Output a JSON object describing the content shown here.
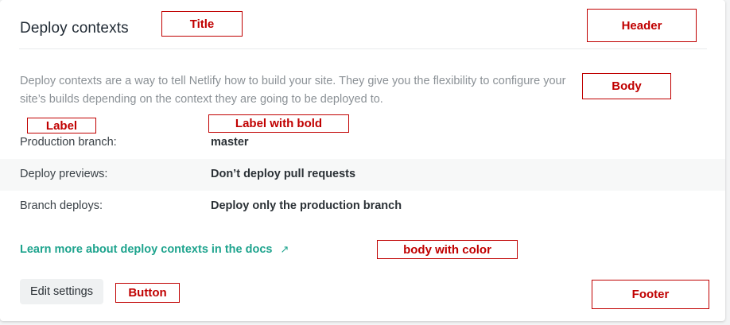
{
  "card": {
    "title": "Deploy contexts",
    "description": "Deploy contexts are a way to tell Netlify how to build your site. They give you the flexibility to configure your site’s builds depending on the context they are going to be deployed to.",
    "rows": [
      {
        "label": "Production branch:",
        "value": "master"
      },
      {
        "label": "Deploy previews:",
        "value": "Don’t deploy pull requests"
      },
      {
        "label": "Branch deploys:",
        "value": "Deploy only the production branch"
      }
    ],
    "docs_link": "Learn more about deploy contexts in the docs",
    "docs_link_icon": "↗",
    "edit_button": "Edit settings"
  },
  "annotations": {
    "title": "Title",
    "header": "Header",
    "body": "Body",
    "label": "Label",
    "label_bold": "Label with bold",
    "body_color": "body with color",
    "button": "Button",
    "footer": "Footer"
  },
  "colors": {
    "link": "#1fa48e",
    "annotation": "#c00000",
    "button_bg": "#eff1f2"
  }
}
